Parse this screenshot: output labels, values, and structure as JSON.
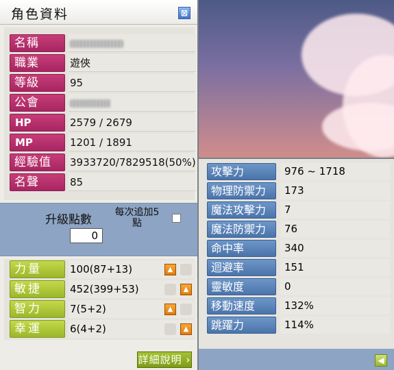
{
  "window": {
    "title": "角色資料",
    "close_glyph": "⊠"
  },
  "info": [
    {
      "label": "名稱",
      "value": ""
    },
    {
      "label": "職業",
      "value": "遊俠"
    },
    {
      "label": "等級",
      "value": "95"
    },
    {
      "label": "公會",
      "value": ""
    },
    {
      "label": "HP",
      "value": "2579 / 2679"
    },
    {
      "label": "MP",
      "value": "1201 / 1891"
    },
    {
      "label": "經驗值",
      "value": "3933720/7829518(50%)"
    },
    {
      "label": "名聲",
      "value": "85"
    }
  ],
  "levelup": {
    "label": "升級點數",
    "points": "0",
    "each_add": "每次追加5點"
  },
  "stats": [
    {
      "label": "力量",
      "value": "100(87+13)"
    },
    {
      "label": "敏捷",
      "value": "452(399+53)"
    },
    {
      "label": "智力",
      "value": "7(5+2)"
    },
    {
      "label": "幸運",
      "value": "6(4+2)"
    }
  ],
  "detail_button": "詳細說明",
  "detail_stats": [
    {
      "label": "攻擊力",
      "value": "976 ~ 1718"
    },
    {
      "label": "物理防禦力",
      "value": "173"
    },
    {
      "label": "魔法攻擊力",
      "value": "7"
    },
    {
      "label": "魔法防禦力",
      "value": "76"
    },
    {
      "label": "命中率",
      "value": "340"
    },
    {
      "label": "迴避率",
      "value": "151"
    },
    {
      "label": "靈敏度",
      "value": "0"
    },
    {
      "label": "移動速度",
      "value": "132%"
    },
    {
      "label": "跳躍力",
      "value": "114%"
    }
  ],
  "icons": {
    "up_arrow": "up-arrow-icon",
    "back_arrow": "left-arrow-icon"
  },
  "colors": {
    "info_label": "#b12f6a",
    "stat_label": "#a9c23a",
    "detail_label": "#5a82b8",
    "panel_blue": "#8da4c4"
  }
}
